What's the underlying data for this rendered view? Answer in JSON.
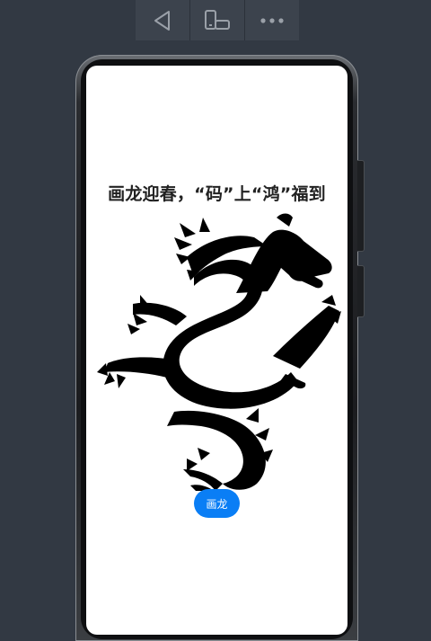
{
  "toolbar": {
    "buttons": [
      {
        "icon": "back-triangle-icon"
      },
      {
        "icon": "device-rotate-icon"
      },
      {
        "icon": "more-dots-icon"
      }
    ]
  },
  "app": {
    "title": "画龙迎春，“码”上“鸿”福到",
    "draw_button_label": "画龙",
    "image": "dragon-silhouette"
  },
  "colors": {
    "background": "#323943",
    "toolbar": "#3c434d",
    "screen": "#ffffff",
    "button": "#0a7ef5",
    "title": "#222222"
  }
}
